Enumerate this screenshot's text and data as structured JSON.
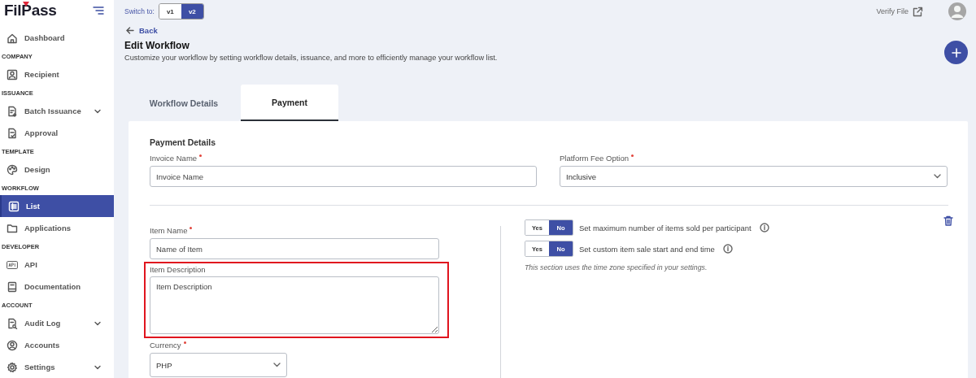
{
  "logo": {
    "text": "FilPass"
  },
  "sidebar": {
    "sections": [
      {
        "items": [
          {
            "label": "Dashboard",
            "selected": false,
            "expandable": false
          }
        ]
      },
      {
        "heading": "COMPANY",
        "items": [
          {
            "label": "Recipient",
            "selected": false,
            "expandable": false
          }
        ]
      },
      {
        "heading": "ISSUANCE",
        "items": [
          {
            "label": "Batch Issuance",
            "selected": false,
            "expandable": true
          },
          {
            "label": "Approval",
            "selected": false,
            "expandable": false
          }
        ]
      },
      {
        "heading": "TEMPLATE",
        "items": [
          {
            "label": "Design",
            "selected": false,
            "expandable": false
          }
        ]
      },
      {
        "heading": "WORKFLOW",
        "items": [
          {
            "label": "List",
            "selected": true,
            "expandable": false
          },
          {
            "label": "Applications",
            "selected": false,
            "expandable": false
          }
        ]
      },
      {
        "heading": "DEVELOPER",
        "items": [
          {
            "label": "API",
            "selected": false,
            "expandable": false
          },
          {
            "label": "Documentation",
            "selected": false,
            "expandable": false
          }
        ]
      },
      {
        "heading": "ACCOUNT",
        "items": [
          {
            "label": "Audit Log",
            "selected": false,
            "expandable": true
          },
          {
            "label": "Accounts",
            "selected": false,
            "expandable": false
          },
          {
            "label": "Settings",
            "selected": false,
            "expandable": true
          }
        ]
      }
    ]
  },
  "topbar": {
    "switch_label": "Switch to:",
    "versions": [
      {
        "label": "v1",
        "selected": false
      },
      {
        "label": "v2",
        "selected": true
      }
    ],
    "verify_link": "Verify File"
  },
  "back": "Back",
  "page": {
    "title": "Edit Workflow",
    "subtitle": "Customize your workflow by setting workflow details, issuance, and more to efficiently manage your workflow list."
  },
  "tabs": [
    {
      "label": "Workflow Details",
      "selected": false
    },
    {
      "label": "Payment",
      "selected": true
    }
  ],
  "payment": {
    "heading": "Payment Details",
    "invoice": {
      "label": "Invoice Name",
      "required": true,
      "placeholder": "Invoice Name"
    },
    "fee": {
      "label": "Platform Fee Option",
      "required": true,
      "value": "Inclusive"
    },
    "item_name": {
      "label": "Item Name",
      "required": true,
      "placeholder": "Name of Item",
      "highlighted": false
    },
    "item_description": {
      "label": "Item Description",
      "required": false,
      "placeholder": "Item Description",
      "highlighted": true
    },
    "currency": {
      "label": "Currency",
      "required": true,
      "value": "PHP"
    },
    "toggles": [
      {
        "yes": "Yes",
        "no": "No",
        "on": false,
        "label": "Set maximum number of items sold per participant"
      },
      {
        "yes": "Yes",
        "no": "No",
        "on": false,
        "label": "Set custom item sale start and end time"
      }
    ],
    "note": "This section uses the time zone specified in your settings."
  }
}
